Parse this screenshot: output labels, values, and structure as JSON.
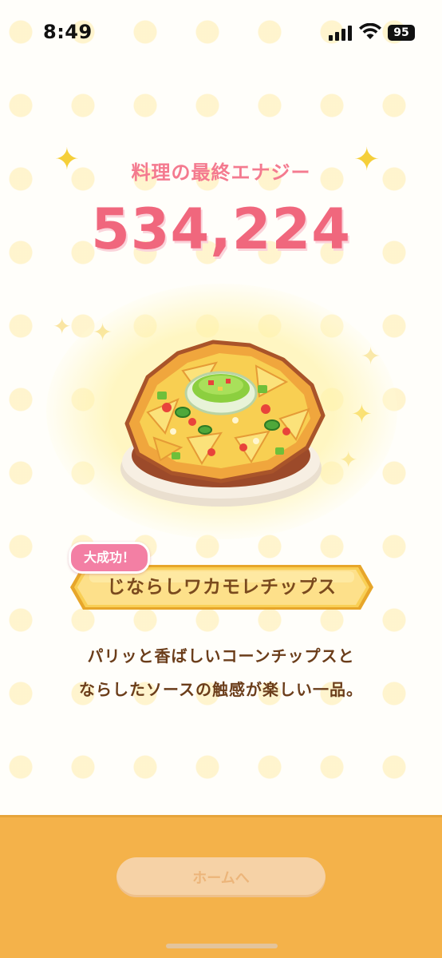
{
  "status_bar": {
    "time": "8:49",
    "battery": "95"
  },
  "result": {
    "energy_label": "料理の最終エナジー",
    "energy_value": "534,224"
  },
  "dish": {
    "badge": "大成功！",
    "name": "じならしワカモレチップス",
    "description_lines": [
      "パリッと香ばしいコーンチップスと",
      "ならしたソースの触感が楽しい一品。"
    ]
  },
  "footer": {
    "home_button": "ホームへ"
  },
  "colors": {
    "energy_text": "#f0677d",
    "banner_gold": "#f9c94a",
    "badge_pink": "#f37fa4",
    "bottom_panel": "#f4b24a"
  }
}
